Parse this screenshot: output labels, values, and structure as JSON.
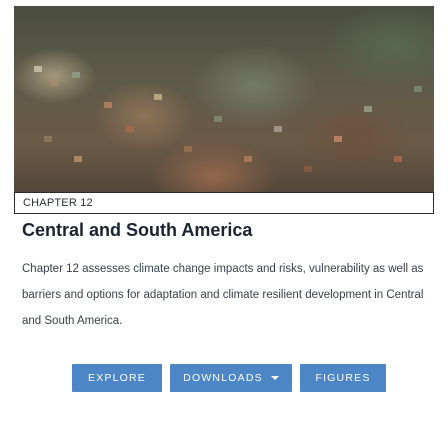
{
  "card": {
    "chapter_label": "CHAPTER 12",
    "title": "Central and South America",
    "description": "Chapter 12 assesses climate change impacts and risks, vulnerability as well as barriers and options for adaptation and climate resilient development in Central and South America.",
    "image_alt": "Aerial view of a dense hillside city"
  },
  "buttons": {
    "explore": "EXPLORE",
    "downloads": "DOWNLOADS",
    "figures": "FIGURES"
  },
  "colors": {
    "button": "#4d86c6",
    "title": "#1c2330",
    "text": "#3a404b"
  }
}
